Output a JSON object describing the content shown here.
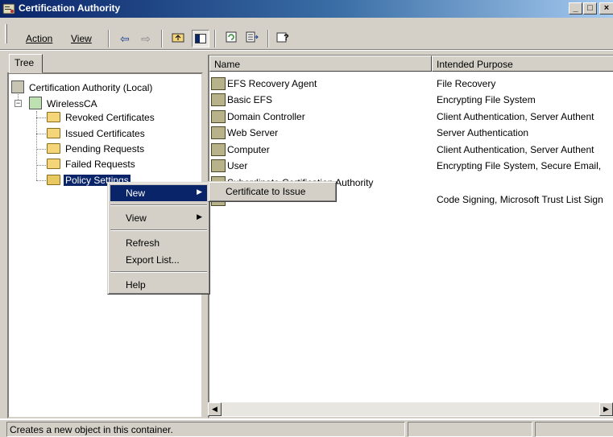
{
  "window": {
    "title": "Certification Authority",
    "controls": {
      "minimize": "_",
      "maximize": "□",
      "close": "×"
    }
  },
  "menubar": {
    "action_label": "Action",
    "view_label": "View"
  },
  "toolbar": {
    "icons": [
      "back-arrow-icon",
      "forward-arrow-icon",
      "up-folder-icon",
      "show-tree-icon",
      "refresh-icon",
      "export-list-icon",
      "help-icon"
    ]
  },
  "tree": {
    "tab_label": "Tree",
    "root": "Certification Authority (Local)",
    "ca": "WirelessCA",
    "folders": [
      "Revoked Certificates",
      "Issued Certificates",
      "Pending Requests",
      "Failed Requests",
      "Policy Settings"
    ],
    "selected": "Policy Settings"
  },
  "list": {
    "columns": [
      "Name",
      "Intended Purpose"
    ],
    "rows": [
      {
        "name": "EFS Recovery Agent",
        "purpose": "File Recovery"
      },
      {
        "name": "Basic EFS",
        "purpose": "Encrypting File System"
      },
      {
        "name": "Domain Controller",
        "purpose": "Client Authentication, Server Authent"
      },
      {
        "name": "Web Server",
        "purpose": "Server Authentication"
      },
      {
        "name": "Computer",
        "purpose": "Client Authentication, Server Authent"
      },
      {
        "name": "User",
        "purpose": "Encrypting File System, Secure Email,"
      },
      {
        "name": "Subordinate Certification Authority",
        "purpose": ""
      },
      {
        "name": "",
        "purpose": "Code Signing, Microsoft Trust List Sign"
      }
    ]
  },
  "context_menu": {
    "items": [
      "New",
      "View",
      "Refresh",
      "Export List...",
      "Help"
    ],
    "highlighted": "New",
    "submenu": {
      "items": [
        "Certificate to Issue"
      ]
    }
  },
  "status": {
    "text": "Creates a new object in this container."
  }
}
